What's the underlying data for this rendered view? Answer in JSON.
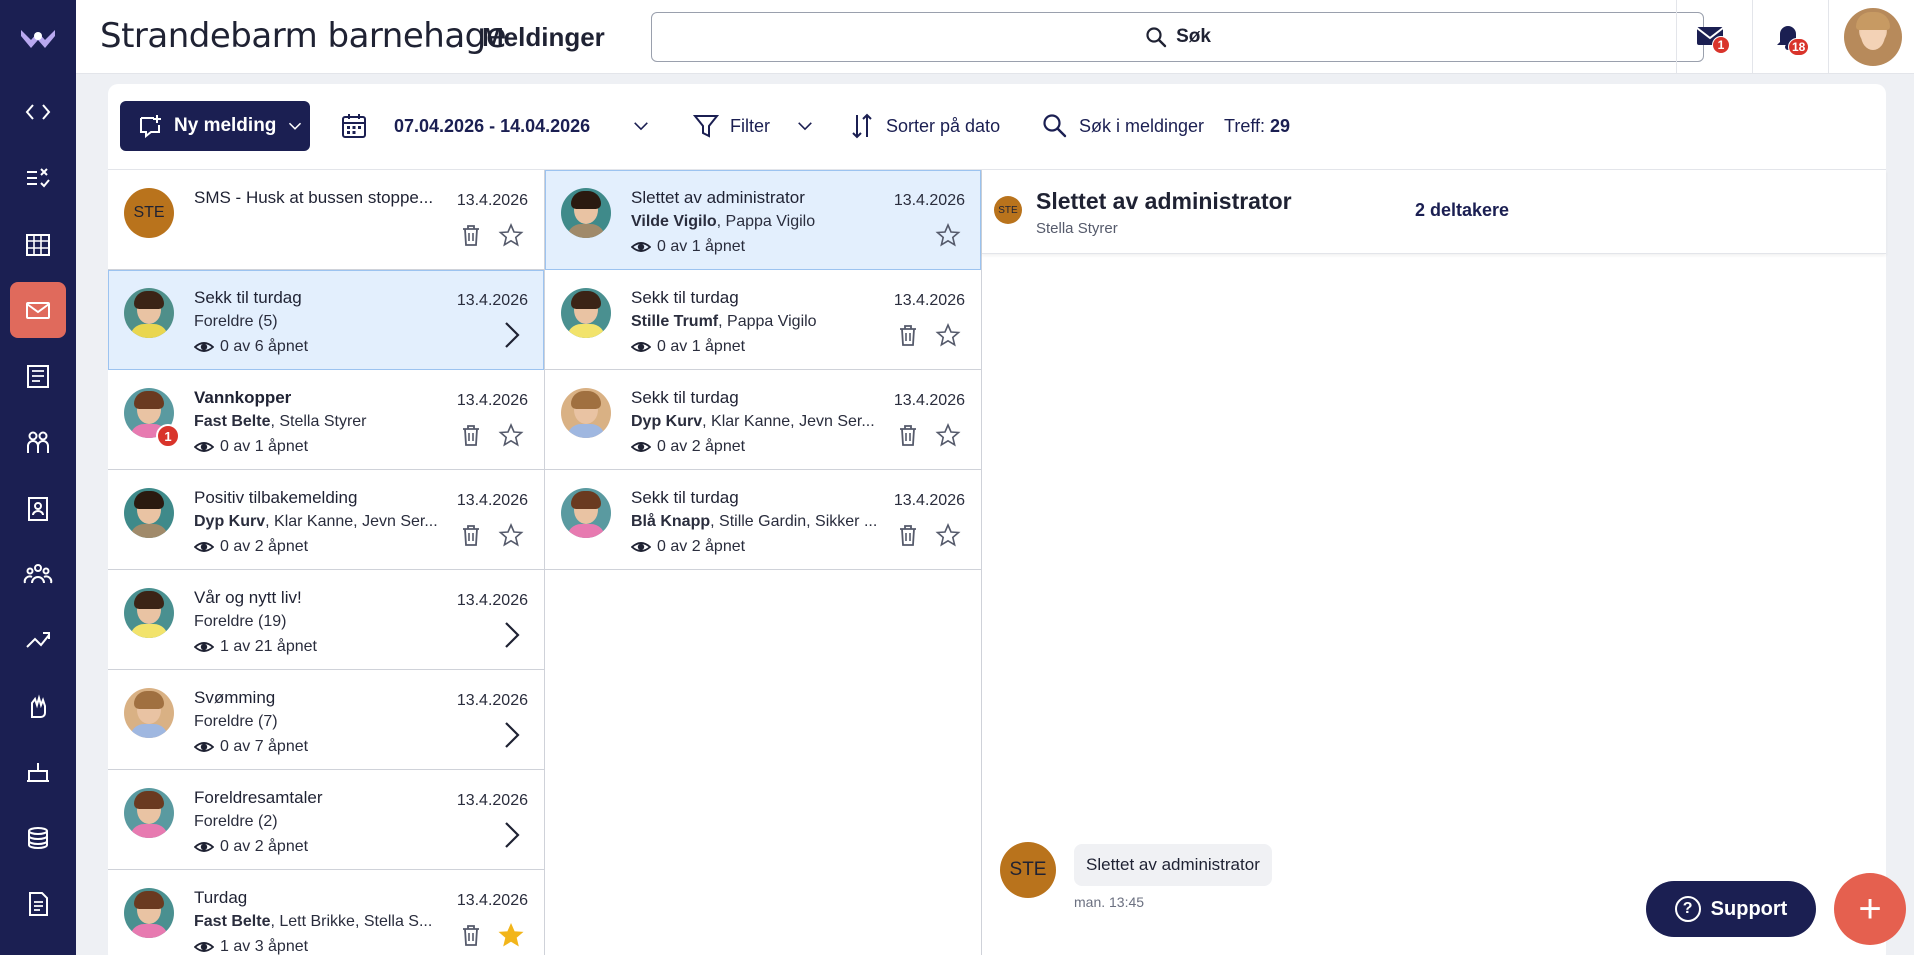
{
  "app": {
    "org_name": "Strandebarm barnehage",
    "page_title": "Meldinger",
    "accent": "#1b1f52",
    "active_nav": "#e06a5c"
  },
  "search": {
    "label": "Søk"
  },
  "header": {
    "messages_badge": "1",
    "notifications_badge": "18"
  },
  "nav": [
    "code-icon",
    "tasks-icon",
    "calendar-icon",
    "mail-icon",
    "news-icon",
    "children-icon",
    "contacts-icon",
    "groups-icon",
    "activities-icon",
    "hand-icon",
    "meals-icon",
    "payments-icon",
    "documents-icon"
  ],
  "toolbar": {
    "new_message": "Ny melding",
    "date_range": "07.04.2026 - 14.04.2026",
    "filter": "Filter",
    "sort": "Sorter på dato",
    "search_messages": "Søk i meldinger",
    "hits_label": "Treff:",
    "hits_value": "29"
  },
  "list1": [
    {
      "subject": "SMS - Husk at bussen stoppe...",
      "recip_bold": "",
      "recip_rest": "",
      "seen": "",
      "date": "13.4.2026",
      "avatar": "STE",
      "mode": "actions",
      "starred": false
    },
    {
      "subject": "Sekk til turdag",
      "recip_bold": "",
      "recip_rest": "Foreldre (5)",
      "seen": "0 av 6 åpnet",
      "date": "13.4.2026",
      "mode": "chevron",
      "selected": true
    },
    {
      "subject": "Vannkopper",
      "recip_bold": "Fast Belte",
      "recip_rest": ", Stella Styrer",
      "seen": "0 av 1 åpnet",
      "date": "13.4.2026",
      "mode": "actions",
      "unread": "1",
      "bold": true
    },
    {
      "subject": "Positiv tilbakemelding",
      "recip_bold": "Dyp Kurv",
      "recip_rest": ", Klar Kanne, Jevn Ser...",
      "seen": "0 av 2 åpnet",
      "date": "13.4.2026",
      "mode": "actions"
    },
    {
      "subject": "Vår og nytt liv!",
      "recip_bold": "",
      "recip_rest": "Foreldre (19)",
      "seen": "1 av 21 åpnet",
      "date": "13.4.2026",
      "mode": "chevron"
    },
    {
      "subject": "Svømming",
      "recip_bold": "",
      "recip_rest": "Foreldre (7)",
      "seen": "0 av 7 åpnet",
      "date": "13.4.2026",
      "mode": "chevron"
    },
    {
      "subject": "Foreldresamtaler",
      "recip_bold": "",
      "recip_rest": "Foreldre (2)",
      "seen": "0 av 2 åpnet",
      "date": "13.4.2026",
      "mode": "chevron"
    },
    {
      "subject": "Turdag",
      "recip_bold": "Fast Belte",
      "recip_rest": ", Lett Brikke, Stella S...",
      "seen": "1 av 3 åpnet",
      "date": "13.4.2026",
      "mode": "actions",
      "starred": true
    }
  ],
  "list2": [
    {
      "subject": "Slettet av administrator",
      "recip_bold": "Vilde Vigilo",
      "recip_rest": ", Pappa Vigilo",
      "seen": "0 av 1 åpnet",
      "date": "13.4.2026",
      "mode": "star",
      "selected": true
    },
    {
      "subject": "Sekk til turdag",
      "recip_bold": "Stille Trumf",
      "recip_rest": ", Pappa Vigilo",
      "seen": "0 av 1 åpnet",
      "date": "13.4.2026",
      "mode": "actions"
    },
    {
      "subject": "Sekk til turdag",
      "recip_bold": "Dyp Kurv",
      "recip_rest": ", Klar Kanne, Jevn Ser...",
      "seen": "0 av 2 åpnet",
      "date": "13.4.2026",
      "mode": "actions"
    },
    {
      "subject": "Sekk til turdag",
      "recip_bold": "Blå Knapp",
      "recip_rest": ", Stille Gardin, Sikker ...",
      "seen": "0 av 2 åpnet",
      "date": "13.4.2026",
      "mode": "actions"
    }
  ],
  "detail": {
    "avatar": "STE",
    "title": "Slettet av administrator",
    "sender": "Stella Styrer",
    "participants": "2 deltakere",
    "message_avatar": "STE",
    "message_text": "Slettet av administrator",
    "message_time": "man. 13:45"
  },
  "support_label": "Support",
  "fab_label": "+"
}
